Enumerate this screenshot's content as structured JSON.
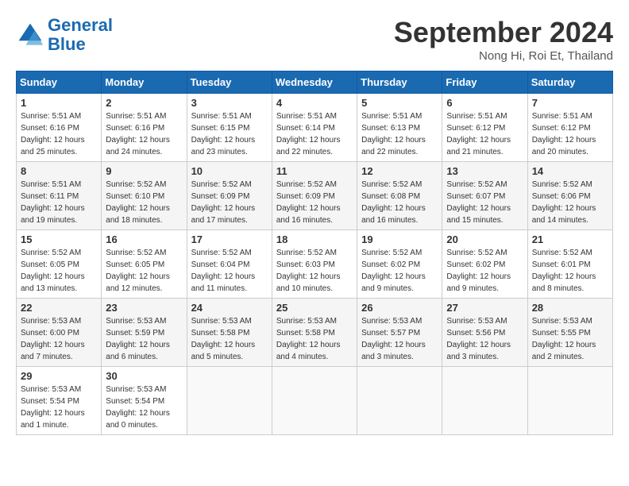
{
  "header": {
    "logo_line1": "General",
    "logo_line2": "Blue",
    "month": "September 2024",
    "location": "Nong Hi, Roi Et, Thailand"
  },
  "weekdays": [
    "Sunday",
    "Monday",
    "Tuesday",
    "Wednesday",
    "Thursday",
    "Friday",
    "Saturday"
  ],
  "weeks": [
    [
      {
        "day": "1",
        "sunrise": "5:51 AM",
        "sunset": "6:16 PM",
        "daylight": "12 hours and 25 minutes."
      },
      {
        "day": "2",
        "sunrise": "5:51 AM",
        "sunset": "6:16 PM",
        "daylight": "12 hours and 24 minutes."
      },
      {
        "day": "3",
        "sunrise": "5:51 AM",
        "sunset": "6:15 PM",
        "daylight": "12 hours and 23 minutes."
      },
      {
        "day": "4",
        "sunrise": "5:51 AM",
        "sunset": "6:14 PM",
        "daylight": "12 hours and 22 minutes."
      },
      {
        "day": "5",
        "sunrise": "5:51 AM",
        "sunset": "6:13 PM",
        "daylight": "12 hours and 22 minutes."
      },
      {
        "day": "6",
        "sunrise": "5:51 AM",
        "sunset": "6:12 PM",
        "daylight": "12 hours and 21 minutes."
      },
      {
        "day": "7",
        "sunrise": "5:51 AM",
        "sunset": "6:12 PM",
        "daylight": "12 hours and 20 minutes."
      }
    ],
    [
      {
        "day": "8",
        "sunrise": "5:51 AM",
        "sunset": "6:11 PM",
        "daylight": "12 hours and 19 minutes."
      },
      {
        "day": "9",
        "sunrise": "5:52 AM",
        "sunset": "6:10 PM",
        "daylight": "12 hours and 18 minutes."
      },
      {
        "day": "10",
        "sunrise": "5:52 AM",
        "sunset": "6:09 PM",
        "daylight": "12 hours and 17 minutes."
      },
      {
        "day": "11",
        "sunrise": "5:52 AM",
        "sunset": "6:09 PM",
        "daylight": "12 hours and 16 minutes."
      },
      {
        "day": "12",
        "sunrise": "5:52 AM",
        "sunset": "6:08 PM",
        "daylight": "12 hours and 16 minutes."
      },
      {
        "day": "13",
        "sunrise": "5:52 AM",
        "sunset": "6:07 PM",
        "daylight": "12 hours and 15 minutes."
      },
      {
        "day": "14",
        "sunrise": "5:52 AM",
        "sunset": "6:06 PM",
        "daylight": "12 hours and 14 minutes."
      }
    ],
    [
      {
        "day": "15",
        "sunrise": "5:52 AM",
        "sunset": "6:05 PM",
        "daylight": "12 hours and 13 minutes."
      },
      {
        "day": "16",
        "sunrise": "5:52 AM",
        "sunset": "6:05 PM",
        "daylight": "12 hours and 12 minutes."
      },
      {
        "day": "17",
        "sunrise": "5:52 AM",
        "sunset": "6:04 PM",
        "daylight": "12 hours and 11 minutes."
      },
      {
        "day": "18",
        "sunrise": "5:52 AM",
        "sunset": "6:03 PM",
        "daylight": "12 hours and 10 minutes."
      },
      {
        "day": "19",
        "sunrise": "5:52 AM",
        "sunset": "6:02 PM",
        "daylight": "12 hours and 9 minutes."
      },
      {
        "day": "20",
        "sunrise": "5:52 AM",
        "sunset": "6:02 PM",
        "daylight": "12 hours and 9 minutes."
      },
      {
        "day": "21",
        "sunrise": "5:52 AM",
        "sunset": "6:01 PM",
        "daylight": "12 hours and 8 minutes."
      }
    ],
    [
      {
        "day": "22",
        "sunrise": "5:53 AM",
        "sunset": "6:00 PM",
        "daylight": "12 hours and 7 minutes."
      },
      {
        "day": "23",
        "sunrise": "5:53 AM",
        "sunset": "5:59 PM",
        "daylight": "12 hours and 6 minutes."
      },
      {
        "day": "24",
        "sunrise": "5:53 AM",
        "sunset": "5:58 PM",
        "daylight": "12 hours and 5 minutes."
      },
      {
        "day": "25",
        "sunrise": "5:53 AM",
        "sunset": "5:58 PM",
        "daylight": "12 hours and 4 minutes."
      },
      {
        "day": "26",
        "sunrise": "5:53 AM",
        "sunset": "5:57 PM",
        "daylight": "12 hours and 3 minutes."
      },
      {
        "day": "27",
        "sunrise": "5:53 AM",
        "sunset": "5:56 PM",
        "daylight": "12 hours and 3 minutes."
      },
      {
        "day": "28",
        "sunrise": "5:53 AM",
        "sunset": "5:55 PM",
        "daylight": "12 hours and 2 minutes."
      }
    ],
    [
      {
        "day": "29",
        "sunrise": "5:53 AM",
        "sunset": "5:54 PM",
        "daylight": "12 hours and 1 minute."
      },
      {
        "day": "30",
        "sunrise": "5:53 AM",
        "sunset": "5:54 PM",
        "daylight": "12 hours and 0 minutes."
      },
      null,
      null,
      null,
      null,
      null
    ]
  ]
}
